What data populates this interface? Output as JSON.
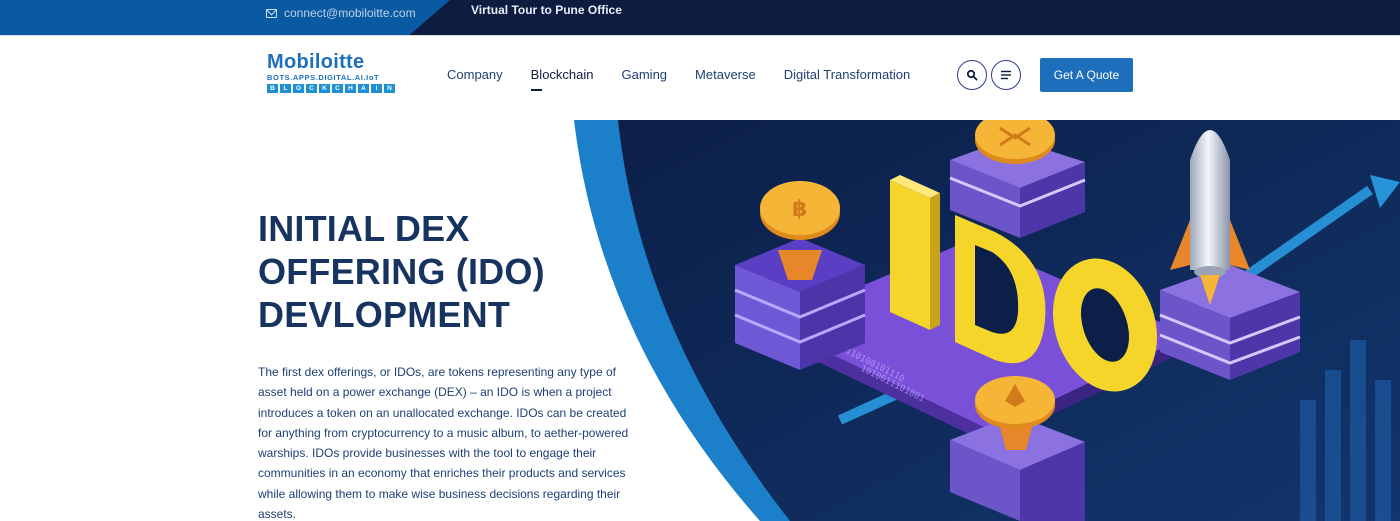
{
  "topbar": {
    "email": "connect@mobiloitte.com",
    "tour": "Virtual Tour to Pune Office"
  },
  "logo": {
    "name": "Mobiloitte",
    "tagline": "BOTS.APPS.DIGITAL.AI.IoT",
    "chain_letters": [
      "B",
      "L",
      "O",
      "C",
      "K",
      "C",
      "H",
      "A",
      "I",
      "N"
    ]
  },
  "nav": {
    "items": [
      "Company",
      "Blockchain",
      "Gaming",
      "Metaverse",
      "Digital Transformation"
    ],
    "active": "Blockchain"
  },
  "header": {
    "search_icon": "search-icon",
    "menu_icon": "hamburger-menu-icon",
    "quote_label": "Get A Quote"
  },
  "hero": {
    "title_lines": [
      "INITIAL DEX",
      "OFFERING (IDO)",
      "DEVLOPMENT"
    ],
    "description": "The first dex offerings, or IDOs, are tokens representing any type of asset held on a power exchange (DEX) – an IDO is when a project introduces a token on an unallocated exchange. IDOs can be created for anything from cryptocurrency to a music album, to aether-powered warships. IDOs provide businesses with the tool to engage their communities in an economy that enriches their products and services while allowing them to make wise business decisions regarding their assets.",
    "art_text": "IDO"
  },
  "colors": {
    "topbar_dark": "#0e1d3f",
    "topbar_blue": "#0a5aa3",
    "brand_blue": "#1d6fbb",
    "title": "#16345f"
  }
}
